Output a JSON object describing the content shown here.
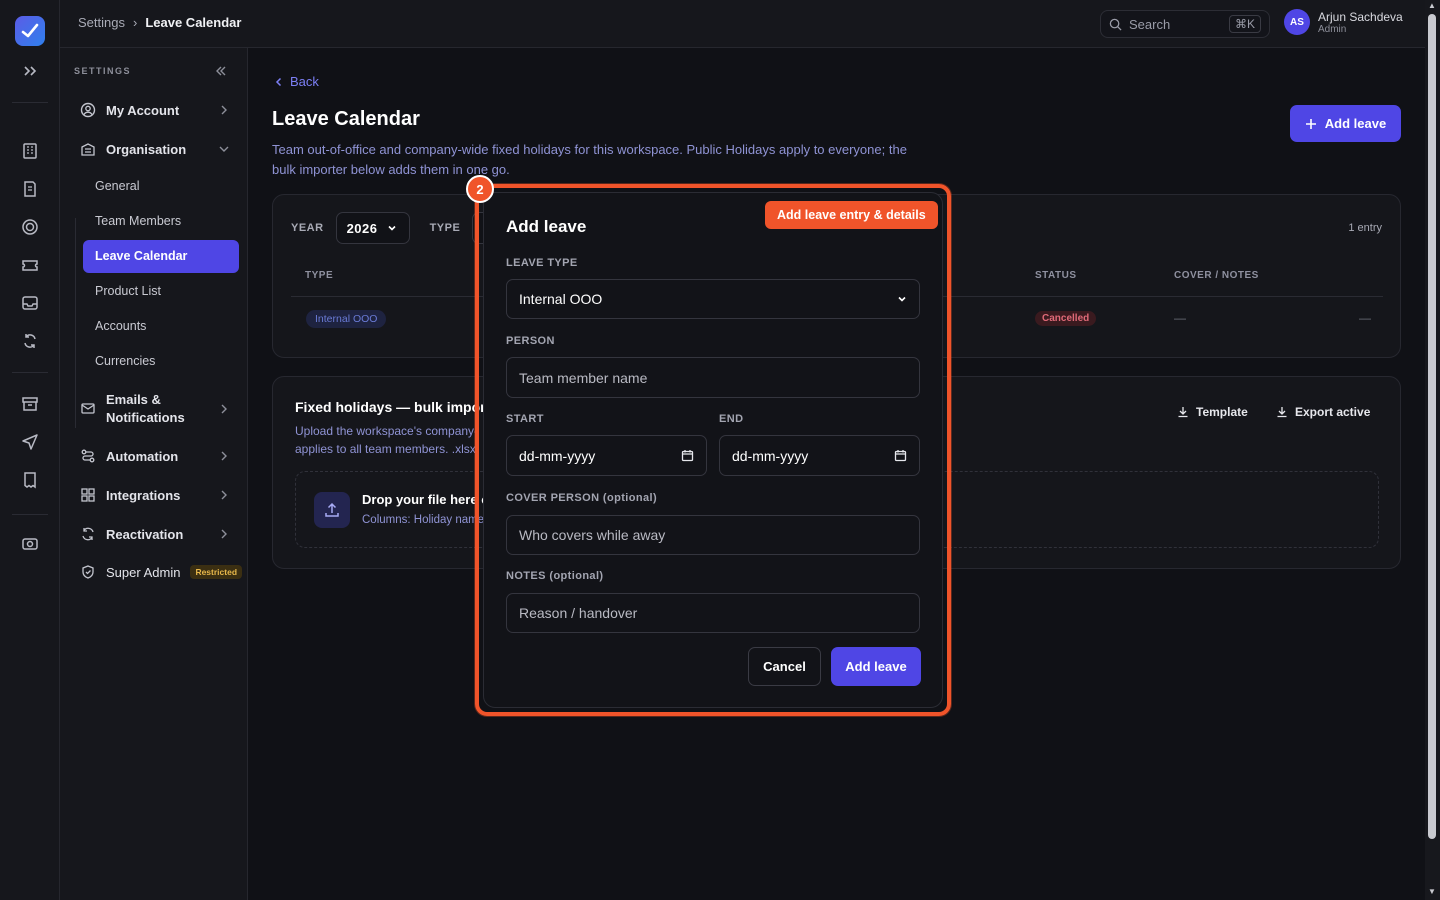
{
  "topbar": {
    "breadcrumb": {
      "parent": "Settings",
      "current": "Leave Calendar"
    },
    "search": {
      "placeholder": "Search",
      "shortcut": "⌘K"
    },
    "user": {
      "initials": "AS",
      "name": "Arjun Sachdeva",
      "role": "Admin"
    }
  },
  "sidebar": {
    "header": "SETTINGS",
    "items": [
      {
        "label": "My Account",
        "icon": "user-circle-icon"
      },
      {
        "label": "Organisation",
        "icon": "building-icon"
      },
      {
        "label": "Emails & Notifications",
        "line1": "Emails &",
        "line2": "Notifications",
        "icon": "mail-icon"
      },
      {
        "label": "Automation",
        "icon": "automation-icon"
      },
      {
        "label": "Integrations",
        "icon": "grid-icon"
      },
      {
        "label": "Reactivation",
        "icon": "refresh-icon"
      },
      {
        "label": "Super Admin",
        "icon": "shield-icon",
        "badge": "Restricted"
      }
    ],
    "sub_items": [
      "General",
      "Team Members",
      "Leave Calendar",
      "Product List",
      "Accounts",
      "Currencies"
    ],
    "active_sub": "Leave Calendar"
  },
  "page": {
    "back": "Back",
    "title": "Leave Calendar",
    "description": "Team out-of-office and company-wide fixed holidays for this workspace. Public Holidays apply to everyone; the bulk importer below adds them in one go.",
    "add_button": "Add leave"
  },
  "filters": {
    "year_label": "YEAR",
    "year_value": "2026",
    "type_label": "TYPE",
    "entry_count": "1 entry"
  },
  "table": {
    "headers": {
      "type": "TYPE",
      "status": "STATUS",
      "cover": "COVER / NOTES"
    },
    "row": {
      "type": "Internal OOO",
      "status": "Cancelled",
      "cover": "—",
      "action": "—"
    }
  },
  "bulk": {
    "title": "Fixed holidays — bulk impor",
    "desc_line1": "Upload the workspace's company-",
    "desc_line2": "applies to all team members. .xlsx",
    "template_btn": "Template",
    "export_btn": "Export active",
    "drop_title": "Drop your file here o",
    "drop_sub": "Columns: Holiday name"
  },
  "modal": {
    "step": "2",
    "tag": "Add leave entry & details",
    "title": "Add leave",
    "leave_type_label": "LEAVE TYPE",
    "leave_type_value": "Internal OOO",
    "person_label": "PERSON",
    "person_placeholder": "Team member name",
    "start_label": "START",
    "start_placeholder": "dd-mm-yyyy",
    "end_label": "END",
    "end_placeholder": "dd-mm-yyyy",
    "cover_label": "COVER PERSON",
    "cover_optional": "(optional)",
    "cover_placeholder": "Who covers while away",
    "notes_label": "NOTES",
    "notes_optional": "(optional)",
    "notes_placeholder": "Reason / handover",
    "cancel": "Cancel",
    "submit": "Add leave"
  },
  "colors": {
    "accent": "#4f46e5",
    "highlight": "#f0542a",
    "background": "#101116"
  }
}
